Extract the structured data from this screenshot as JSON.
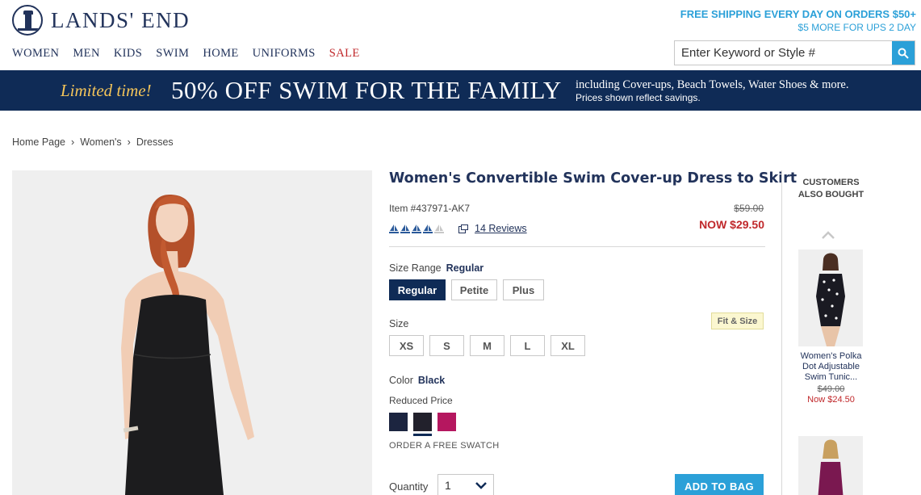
{
  "header": {
    "logo_text": "LANDS' END",
    "shipping_line1": "FREE SHIPPING EVERY DAY ON ORDERS $50+",
    "shipping_line2": "$5 MORE FOR UPS 2 DAY",
    "search_placeholder": "Enter Keyword or Style #",
    "nav": [
      "WOMEN",
      "MEN",
      "KIDS",
      "SWIM",
      "HOME",
      "UNIFORMS",
      "SALE"
    ]
  },
  "banner": {
    "limited": "Limited time!",
    "headline": "50% OFF SWIM FOR THE FAMILY",
    "sub1": "including Cover-ups, Beach Towels, Water Shoes & more.",
    "sub2": "Prices shown reflect savings."
  },
  "breadcrumb": [
    "Home Page",
    "Women's",
    "Dresses"
  ],
  "product": {
    "title": "Women's Convertible Swim Cover-up Dress to Skirt",
    "item_number": "Item #437971-AK7",
    "old_price": "$59.00",
    "now_price": "NOW $29.50",
    "rating": 4,
    "rating_max": 5,
    "reviews": "14 Reviews",
    "size_range_label": "Size Range",
    "size_range_value": "Regular",
    "size_ranges": [
      "Regular",
      "Petite",
      "Plus"
    ],
    "fit_size": "Fit & Size",
    "size_label": "Size",
    "sizes": [
      "XS",
      "S",
      "M",
      "L",
      "XL"
    ],
    "color_label": "Color",
    "color_value": "Black",
    "reduced_price": "Reduced Price",
    "swatches": [
      "#1c2540",
      "#22212c",
      "#b5175f"
    ],
    "swatch_link": "ORDER A FREE SWATCH",
    "quantity_label": "Quantity",
    "quantity_value": "1",
    "add_to_bag": "ADD TO BAG"
  },
  "rail": {
    "title": "CUSTOMERS ALSO BOUGHT",
    "item_name": "Women's Polka Dot Adjustable Swim Tunic...",
    "item_old_price": "$49.00",
    "item_now_price": "Now $24.50"
  },
  "colors": {
    "navy": "#0f2b56",
    "accent_blue": "#2ba0d8",
    "sale_red": "#c0282b"
  }
}
